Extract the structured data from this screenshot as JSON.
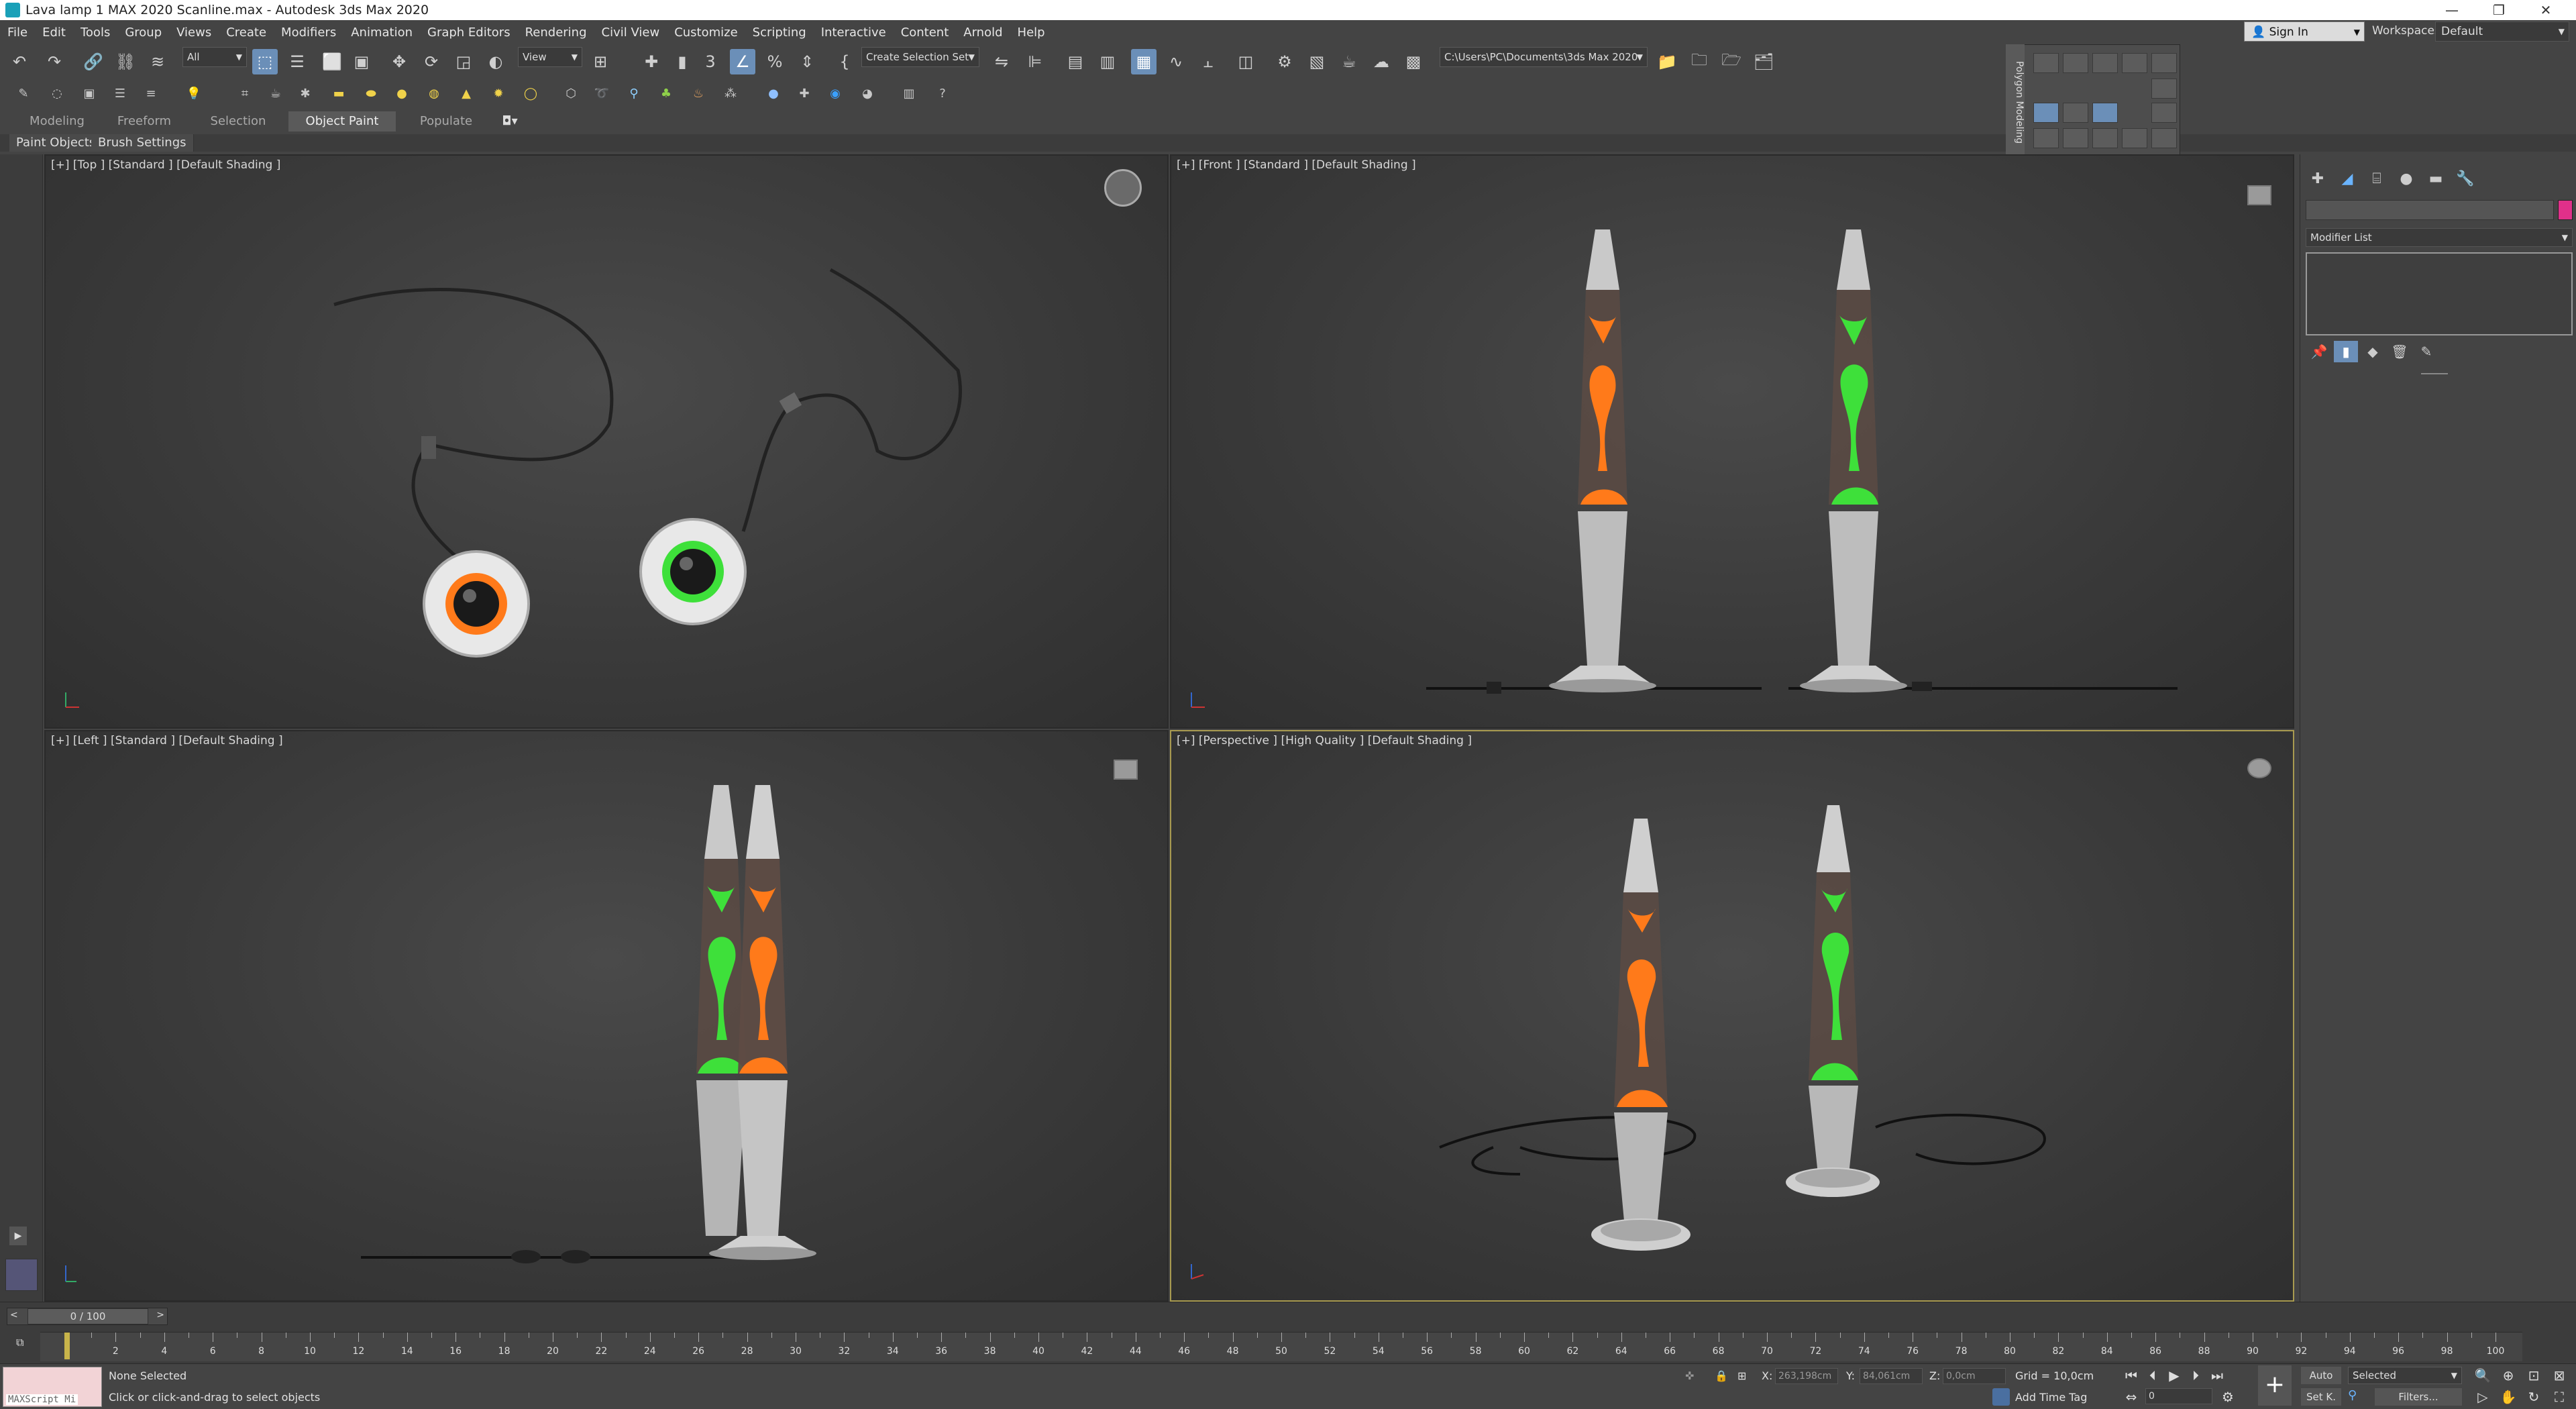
{
  "window": {
    "title": "Lava lamp 1 MAX 2020 Scanline.max - Autodesk 3ds Max 2020",
    "controls": [
      "—",
      "❐",
      "✕"
    ]
  },
  "menu": [
    "File",
    "Edit",
    "Tools",
    "Group",
    "Views",
    "Create",
    "Modifiers",
    "Animation",
    "Graph Editors",
    "Rendering",
    "Civil View",
    "Customize",
    "Scripting",
    "Interactive",
    "Content",
    "Arnold",
    "Help"
  ],
  "account": {
    "signin": "Sign In",
    "workspaces_label": "Workspaces:",
    "workspace": "Default"
  },
  "toolbar": {
    "selection_filter": "All",
    "ref_coord": "View",
    "named_selection": "Create Selection Set",
    "project_path": "C:\\Users\\PC\\Documents\\3ds Max 2020"
  },
  "ribbon": {
    "tabs": [
      "Modeling",
      "Freeform",
      "Selection",
      "Object Paint",
      "Populate"
    ],
    "active_tab": "Object Paint",
    "subtabs": [
      "Paint Objects",
      "Brush Settings"
    ]
  },
  "polygon_panel": {
    "label": "Polygon Modeling"
  },
  "viewports": {
    "top": "[+] [Top ] [Standard ] [Default Shading ]",
    "front": "[+] [Front ] [Standard ] [Default Shading ]",
    "left": "[+] [Left ] [Standard ] [Default Shading ]",
    "perspective": "[+] [Perspective ] [High Quality ] [Default Shading ]"
  },
  "command_panel": {
    "modifier_list": "Modifier List",
    "object_color": "#e0308a"
  },
  "timeline": {
    "frame": "0 / 100",
    "ticks": [
      0,
      2,
      4,
      6,
      8,
      10,
      12,
      14,
      16,
      18,
      20,
      22,
      24,
      26,
      28,
      30,
      32,
      34,
      36,
      38,
      40,
      42,
      44,
      46,
      48,
      50,
      52,
      54,
      56,
      58,
      60,
      62,
      64,
      66,
      68,
      70,
      72,
      74,
      76,
      78,
      80,
      82,
      84,
      86,
      88,
      90,
      92,
      94,
      96,
      98,
      100
    ]
  },
  "status": {
    "maxscript": "MAXScript Mi",
    "selection": "None Selected",
    "prompt": "Click or click-and-drag to select objects",
    "x_label": "X:",
    "x_value": "263,198cm",
    "y_label": "Y:",
    "y_value": "84,061cm",
    "z_label": "Z:",
    "z_value": "0,0cm",
    "grid": "Grid = 10,0cm",
    "add_time_tag": "Add Time Tag",
    "auto": "Auto",
    "selected": "Selected",
    "set_key": "Set K.",
    "filters": "Filters...",
    "frame_field": "0"
  },
  "colors": {
    "orange_lava": "#ff7a1a",
    "green_lava": "#3ee03a",
    "active_vp_border": "#a89a50"
  }
}
